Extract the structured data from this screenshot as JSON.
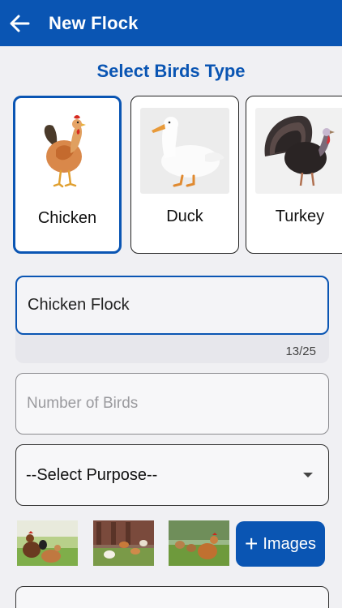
{
  "appbar": {
    "title": "New Flock",
    "back_icon": "arrow-left-icon"
  },
  "section": {
    "title": "Select Birds Type"
  },
  "bird_types": [
    {
      "label": "Chicken",
      "selected": true
    },
    {
      "label": "Duck",
      "selected": false
    },
    {
      "label": "Turkey",
      "selected": false
    }
  ],
  "flock_name": {
    "value": "Chicken Flock",
    "counter": "13/25"
  },
  "bird_count": {
    "placeholder": "Number of Birds"
  },
  "purpose": {
    "selected": "--Select Purpose--",
    "icon": "dropdown-caret-icon"
  },
  "images": {
    "button_label": "Images",
    "icon": "plus-icon"
  },
  "colors": {
    "primary": "#0a55b3",
    "background": "#f0f0f3"
  }
}
